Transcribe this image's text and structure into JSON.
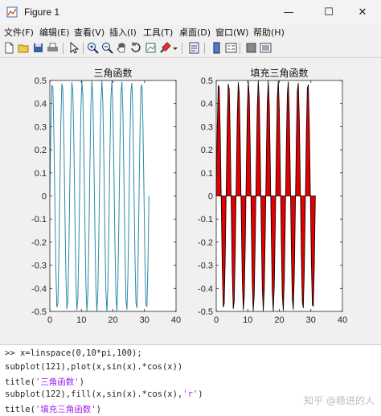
{
  "window": {
    "title": "Figure 1",
    "controls": {
      "minimize": "—",
      "maximize": "☐",
      "close": "✕"
    }
  },
  "menu": [
    "文件(F)",
    "编辑(E)",
    "查看(V)",
    "插入(I)",
    "工具(T)",
    "桌面(D)",
    "窗口(W)",
    "帮助(H)"
  ],
  "toolbar_icons": [
    "new-figure-icon",
    "open-file-icon",
    "save-icon",
    "print-icon",
    "pointer-icon",
    "zoom-in-icon",
    "zoom-out-icon",
    "pan-hand-icon",
    "rotate-3d-icon",
    "data-cursor-icon",
    "brush-icon",
    "dropdown-arrow-icon",
    "link-plot-icon",
    "insert-colorbar-icon",
    "insert-legend-icon",
    "hide-plot-tools-icon",
    "show-plot-tools-icon"
  ],
  "chart_data": [
    {
      "type": "line",
      "title": "三角函数",
      "function": "y = sin(x).*cos(x)",
      "x_domain": [
        0,
        31.4159
      ],
      "num_points": 100,
      "xlim": [
        0,
        40
      ],
      "ylim": [
        -0.5,
        0.5
      ],
      "xticks": [
        "0",
        "10",
        "20",
        "30",
        "40"
      ],
      "yticks": [
        "-0.5",
        "-0.4",
        "-0.3",
        "-0.2",
        "-0.1",
        "0",
        "0.1",
        "0.2",
        "0.3",
        "0.4",
        "0.5"
      ],
      "line_color": "#2a8aa8"
    },
    {
      "type": "area",
      "title": "填充三角函数",
      "function": "fill(x, sin(x).*cos(x), 'r')",
      "x_domain": [
        0,
        31.4159
      ],
      "num_points": 100,
      "xlim": [
        0,
        40
      ],
      "ylim": [
        -0.5,
        0.5
      ],
      "xticks": [
        "0",
        "10",
        "20",
        "30",
        "40"
      ],
      "yticks": [
        "-0.5",
        "-0.4",
        "-0.3",
        "-0.2",
        "-0.1",
        "0",
        "0.1",
        "0.2",
        "0.3",
        "0.4",
        "0.5"
      ],
      "fill_color": "#e00000",
      "edge_color": "#000000"
    }
  ],
  "command_window": {
    "prompt": ">> ",
    "lines": [
      {
        "pre": "x=linspace(0,10*pi,100);",
        "str": "",
        "post": ""
      },
      {
        "pre": "subplot(121),plot(x,sin(x).*cos(x))",
        "str": "",
        "post": ""
      },
      {
        "pre": "title(",
        "str": "'三角函数'",
        "post": ")"
      },
      {
        "pre": "subplot(122),fill(x,sin(x).*cos(x),",
        "str": "'r'",
        "post": ")"
      },
      {
        "pre": "title(",
        "str": "'填充三角函数'",
        "post": ")"
      }
    ]
  },
  "watermark": "知乎 @稳进的人"
}
